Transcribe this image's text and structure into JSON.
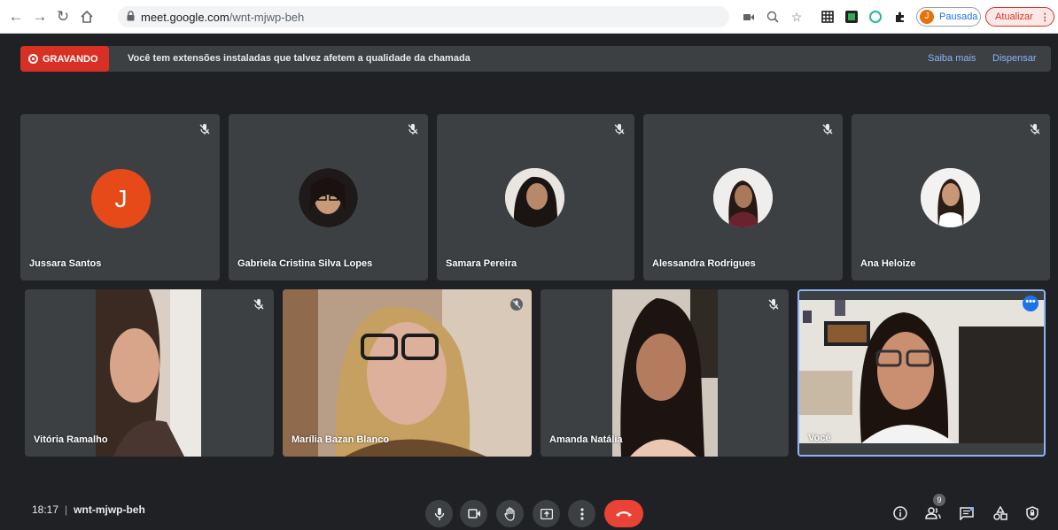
{
  "browser": {
    "url_host": "meet.google.com",
    "url_path": "/wnt-mjwp-beh",
    "profile_initial": "J",
    "profile_status": "Pausada",
    "update_label": "Atualizar",
    "update_menu": "⋮"
  },
  "banner": {
    "recording_label": "GRAVANDO",
    "message": "Você tem extensões instaladas que talvez afetem a qualidade da chamada",
    "learn_more": "Saiba mais",
    "dismiss": "Dispensar"
  },
  "participants": [
    {
      "name": "Jussara Santos",
      "initial": "J"
    },
    {
      "name": "Gabriela Cristina Silva Lopes"
    },
    {
      "name": "Samara Pereira"
    },
    {
      "name": "Alessandra Rodrigues"
    },
    {
      "name": "Ana Heloize"
    },
    {
      "name": "Vitória Ramalho"
    },
    {
      "name": "Marília Bazan Blanco"
    },
    {
      "name": "Amanda Natália"
    },
    {
      "name": "Você",
      "more": "•••"
    }
  ],
  "footer": {
    "time": "18:17",
    "separator": "|",
    "meeting_code": "wnt-mjwp-beh",
    "people_count": "9"
  },
  "colors": {
    "background": "#202124",
    "tile": "#3c4043",
    "recording": "#d93025",
    "end_call": "#ea4335",
    "link": "#8ab4f8"
  }
}
